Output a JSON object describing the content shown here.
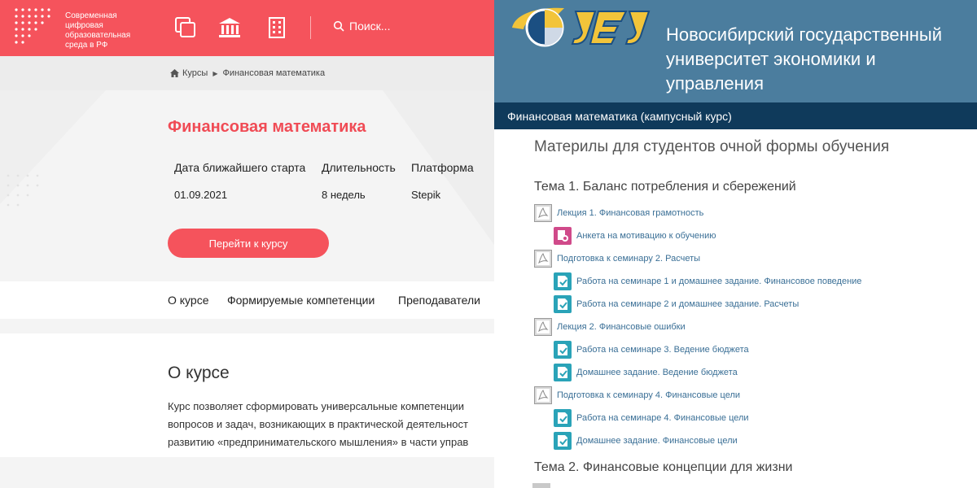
{
  "portal": {
    "logo_lines": [
      "Современная",
      "цифровая",
      "образовательная",
      "среда в РФ"
    ],
    "search_label": "Поиск...",
    "breadcrumb": [
      "Курсы",
      "Финансовая математика"
    ],
    "course": {
      "title": "Финансовая математика",
      "headers": [
        "Дата ближайшего старта",
        "Длительность",
        "Платформа"
      ],
      "values": [
        "01.09.2021",
        "8 недель",
        "Stepik"
      ],
      "button_label": "Перейти к курсу"
    },
    "tabs": [
      "О курсе",
      "Формируемые компетенции",
      "Преподаватели"
    ],
    "about": {
      "title": "О курсе",
      "lines": [
        "Курс позволяет сформировать универсальные компетенции",
        "вопросов и задач, возникающих в практической деятельност",
        "развитию «предпринимательского мышления» в части управ"
      ]
    },
    "colors": {
      "accent": "#f5535c",
      "title": "#f04b55"
    }
  },
  "university": {
    "name_lines": [
      "Новосибирский государственный",
      "университет экономики и",
      "управления"
    ],
    "course_bar": "Финансовая математика (кампусный курс)",
    "section_heading": "Материлы для студентов очной формы обучения",
    "topics": [
      {
        "title": "Тема 1. Баланс потребления и сбережений"
      },
      {
        "title": "Тема 2. Финансовые концепции для жизни"
      }
    ],
    "resources": [
      {
        "label": "Лекция 1. Финансовая грамотность",
        "icon": "pdf-file-icon",
        "level": 0
      },
      {
        "label": "Анкета на мотивацию к обучению",
        "icon": "feedback-icon",
        "level": 1
      },
      {
        "label": "Подготовка к семинару 2. Расчеты",
        "icon": "pdf-file-icon",
        "level": 0
      },
      {
        "label": "Работа на семинаре 1 и домашнее задание. Финансовое поведение",
        "icon": "assignment-icon",
        "level": 1
      },
      {
        "label": "Работа на семинаре 2 и домашнее задание. Расчеты",
        "icon": "assignment-icon",
        "level": 1
      },
      {
        "label": "Лекция 2. Финансовые ошибки",
        "icon": "pdf-file-icon",
        "level": 0
      },
      {
        "label": "Работа на семинаре 3. Ведение бюджета",
        "icon": "assignment-icon",
        "level": 1
      },
      {
        "label": "Домашнее задание. Ведение бюджета",
        "icon": "assignment-icon",
        "level": 1
      },
      {
        "label": "Подготовка к семинару 4. Финансовые цели",
        "icon": "pdf-file-icon",
        "level": 0
      },
      {
        "label": "Работа на семинаре 4. Финансовые цели",
        "icon": "assignment-icon",
        "level": 1
      },
      {
        "label": "Домашнее задание. Финансовые цели",
        "icon": "assignment-icon",
        "level": 1
      }
    ],
    "colors": {
      "header": "#4b7d9e",
      "course_bar": "#0f3a5b",
      "link": "#3a6f96",
      "assignment": "#2aa3b8",
      "feedback": "#d04a8a"
    }
  }
}
